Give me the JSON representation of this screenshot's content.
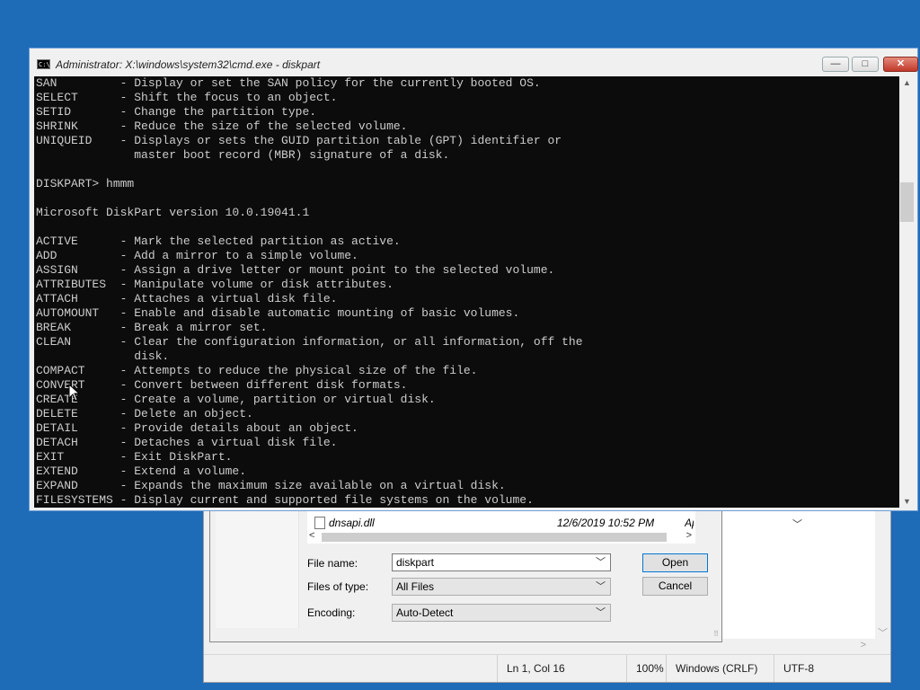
{
  "cmd": {
    "title": "Administrator: X:\\windows\\system32\\cmd.exe - diskpart",
    "icon_text": "C:\\",
    "buttons": {
      "minimize": "—",
      "maximize": "□",
      "close": "✕"
    },
    "lines": [
      "SAN         - Display or set the SAN policy for the currently booted OS.",
      "SELECT      - Shift the focus to an object.",
      "SETID       - Change the partition type.",
      "SHRINK      - Reduce the size of the selected volume.",
      "UNIQUEID    - Displays or sets the GUID partition table (GPT) identifier or",
      "              master boot record (MBR) signature of a disk.",
      "",
      "DISKPART> hmmm",
      "",
      "Microsoft DiskPart version 10.0.19041.1",
      "",
      "ACTIVE      - Mark the selected partition as active.",
      "ADD         - Add a mirror to a simple volume.",
      "ASSIGN      - Assign a drive letter or mount point to the selected volume.",
      "ATTRIBUTES  - Manipulate volume or disk attributes.",
      "ATTACH      - Attaches a virtual disk file.",
      "AUTOMOUNT   - Enable and disable automatic mounting of basic volumes.",
      "BREAK       - Break a mirror set.",
      "CLEAN       - Clear the configuration information, or all information, off the",
      "              disk.",
      "COMPACT     - Attempts to reduce the physical size of the file.",
      "CONVERT     - Convert between different disk formats.",
      "CREATE      - Create a volume, partition or virtual disk.",
      "DELETE      - Delete an object.",
      "DETAIL      - Provide details about an object.",
      "DETACH      - Detaches a virtual disk file.",
      "EXIT        - Exit DiskPart.",
      "EXTEND      - Extend a volume.",
      "EXPAND      - Expands the maximum size available on a virtual disk.",
      "FILESYSTEMS - Display current and supported file systems on the volume."
    ]
  },
  "open_dialog": {
    "file_row": {
      "name": "dnsapi.dll",
      "date": "12/6/2019 10:52 PM",
      "type": "Ap"
    },
    "file_name_label": "File name:",
    "file_name_value": "diskpart",
    "files_of_type_label": "Files of type:",
    "files_of_type_value": "All Files",
    "encoding_label": "Encoding:",
    "encoding_value": "Auto-Detect",
    "open_button": "Open",
    "cancel_button": "Cancel"
  },
  "notepad_status": {
    "position": "Ln 1, Col 16",
    "zoom": "100%",
    "line_ending": "Windows (CRLF)",
    "encoding": "UTF-8"
  }
}
